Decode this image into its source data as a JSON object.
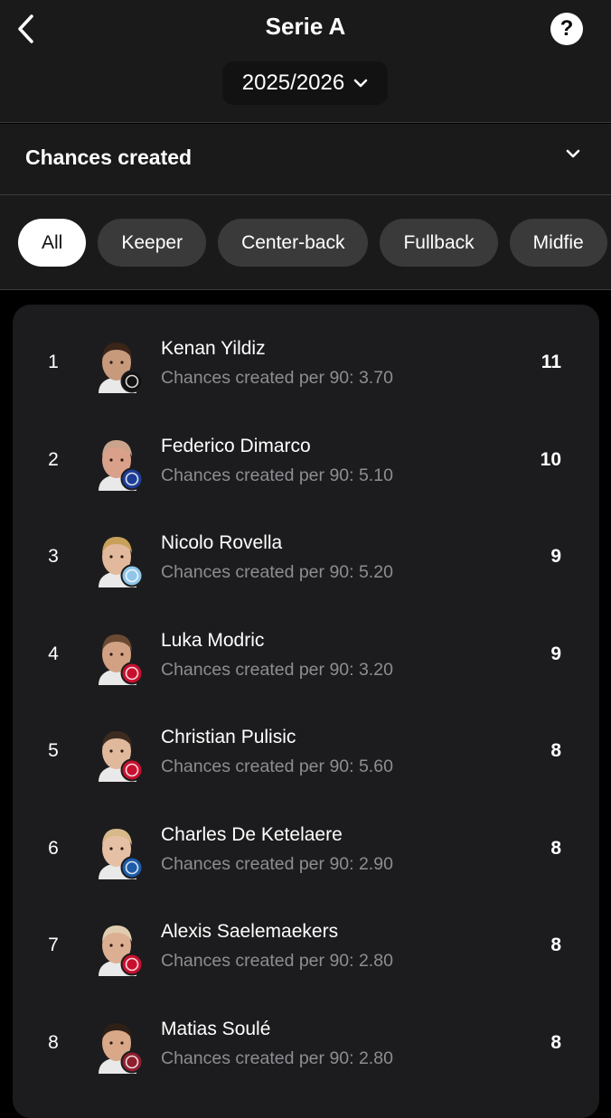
{
  "header": {
    "title": "Serie A",
    "season": "2025/2026",
    "help_label": "?"
  },
  "stat_selector": {
    "label": "Chances created"
  },
  "filters": {
    "chips": [
      {
        "label": "All",
        "active": true
      },
      {
        "label": "Keeper",
        "active": false
      },
      {
        "label": "Center-back",
        "active": false
      },
      {
        "label": "Fullback",
        "active": false
      },
      {
        "label": "Midfie",
        "active": false
      }
    ]
  },
  "players": [
    {
      "rank": "1",
      "name": "Kenan Yildiz",
      "sub": "Chances created per 90: 3.70",
      "value": "11",
      "club": "Juventus",
      "badge_color": "#111111",
      "skin": "#c79a7c",
      "hair": "#3b2418"
    },
    {
      "rank": "2",
      "name": "Federico Dimarco",
      "sub": "Chances created per 90: 5.10",
      "value": "10",
      "club": "Inter",
      "badge_color": "#1d3e96",
      "skin": "#d9a08a",
      "hair": "#c9a38c"
    },
    {
      "rank": "3",
      "name": "Nicolo Rovella",
      "sub": "Chances created per 90: 5.20",
      "value": "9",
      "club": "Lazio",
      "badge_color": "#8fc6ea",
      "skin": "#e2b99c",
      "hair": "#c9a05a"
    },
    {
      "rank": "4",
      "name": "Luka Modric",
      "sub": "Chances created per 90: 3.20",
      "value": "9",
      "club": "Milan",
      "badge_color": "#c8102e",
      "skin": "#d2a184",
      "hair": "#6b4a33"
    },
    {
      "rank": "5",
      "name": "Christian Pulisic",
      "sub": "Chances created per 90: 5.60",
      "value": "8",
      "club": "Milan",
      "badge_color": "#c8102e",
      "skin": "#e0b89c",
      "hair": "#3d2b1f"
    },
    {
      "rank": "6",
      "name": "Charles De Ketelaere",
      "sub": "Chances created per 90: 2.90",
      "value": "8",
      "club": "Atalanta",
      "badge_color": "#1e5ba8",
      "skin": "#e6c0a4",
      "hair": "#d8b98a"
    },
    {
      "rank": "7",
      "name": "Alexis Saelemaekers",
      "sub": "Chances created per 90: 2.80",
      "value": "8",
      "club": "Milan",
      "badge_color": "#c8102e",
      "skin": "#dcae92",
      "hair": "#e0cdb0"
    },
    {
      "rank": "8",
      "name": "Matias Soulé",
      "sub": "Chances created per 90: 2.80",
      "value": "8",
      "club": "Roma",
      "badge_color": "#8e1f2f",
      "skin": "#d8a888",
      "hair": "#2e1f17"
    }
  ]
}
